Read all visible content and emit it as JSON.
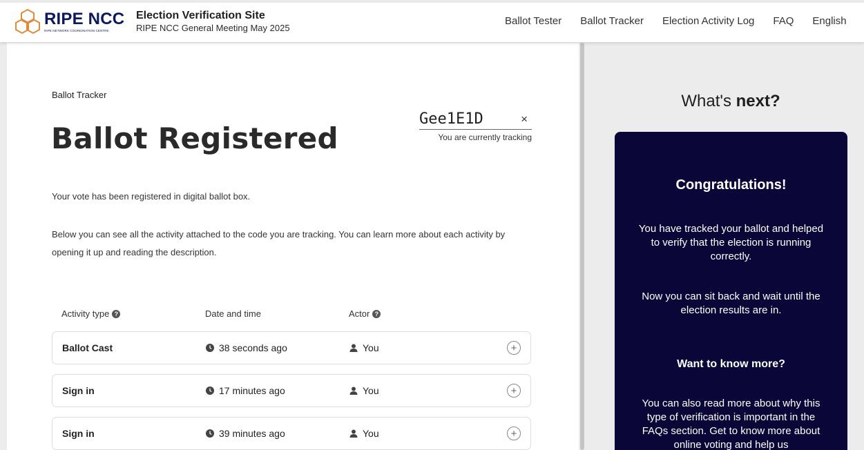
{
  "header": {
    "logo_title": "RIPE NCC",
    "logo_subtitle": "RIPE NETWORK COORDINATION CENTRE",
    "site_name": "Election Verification Site",
    "site_subtitle": "RIPE NCC General Meeting May 2025",
    "nav": [
      "Ballot Tester",
      "Ballot Tracker",
      "Election Activity Log",
      "FAQ",
      "English"
    ]
  },
  "main": {
    "breadcrumb": "Ballot Tracker",
    "title": "Ballot Registered",
    "tracking_code": "Gee1E1D",
    "tracking_close": "×",
    "tracking_caption": "You are currently tracking",
    "paragraph1": "Your vote has been registered in digital ballot box.",
    "paragraph2": "Below you can see all the activity attached to the code you are tracking. You can learn more about each activity by opening it up and reading the description.",
    "columns": {
      "type": "Activity type",
      "time": "Date and time",
      "actor": "Actor"
    },
    "rows": [
      {
        "type": "Ballot Cast",
        "time": "38 seconds ago",
        "actor": "You"
      },
      {
        "type": "Sign in",
        "time": "17 minutes ago",
        "actor": "You"
      },
      {
        "type": "Sign in",
        "time": "39 minutes ago",
        "actor": "You"
      }
    ]
  },
  "sidebar": {
    "title_prefix": "What's ",
    "title_bold": "next?",
    "heading1": "Congratulations!",
    "text1": "You have tracked your ballot and helped to verify that the election is running correctly.",
    "text2": "Now you can sit back and wait until the election results are in.",
    "heading2": "Want to know more?",
    "text3": "You can also read more about why this type of verification is important in the FAQs section. Get to know more about online voting and help us"
  },
  "colors": {
    "brand": "#0a1a5c",
    "card_bg": "#0b0638",
    "logo_orange": "#e08a3c"
  }
}
